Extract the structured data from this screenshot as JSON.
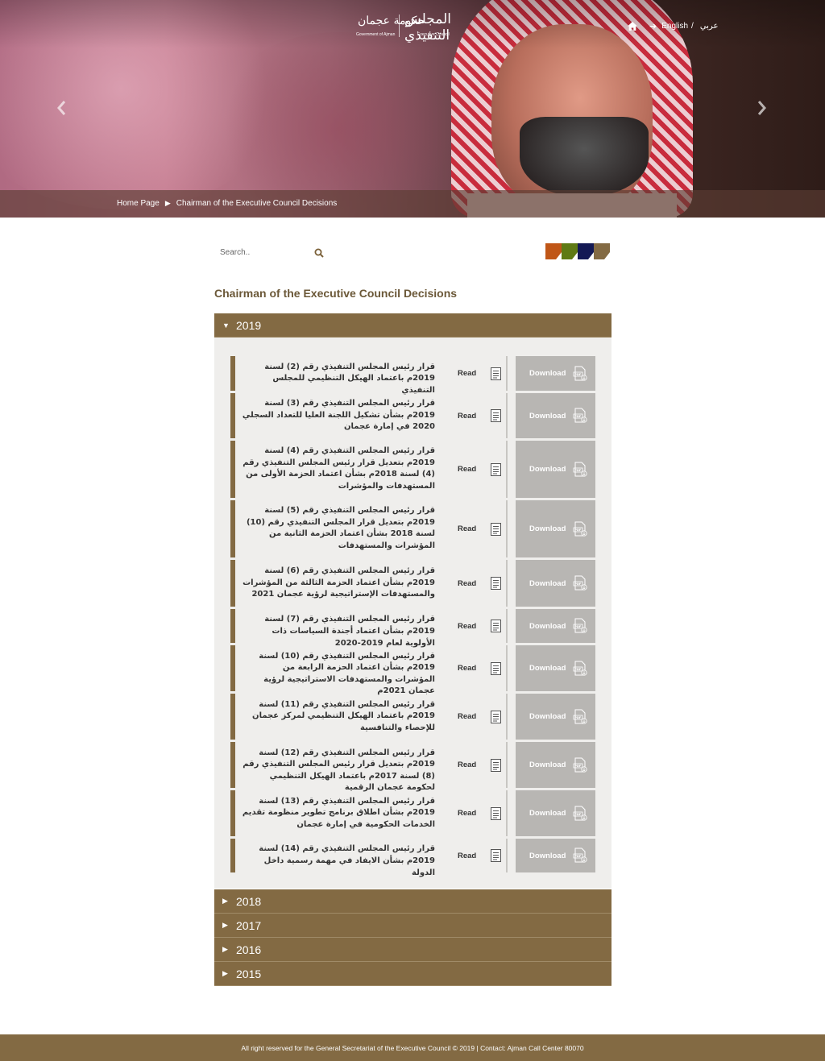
{
  "header": {
    "logo_ar_council": "المجلس التنفيذي",
    "logo_ar_gov": "حكومة عجمان",
    "logo_en_gov": "Government of Ajman",
    "logo_en_council": "Executive Council",
    "lang_english": "English",
    "lang_slash": "/",
    "lang_arabic": "عربي"
  },
  "breadcrumb": {
    "home": "Home Page",
    "current": "Chairman of the Executive Council Decisions"
  },
  "search": {
    "placeholder": "Search.."
  },
  "colors": {
    "brand": "#836a43",
    "themes": [
      "#c05617",
      "#5f7a14",
      "#141954",
      "#836a43"
    ]
  },
  "page_title": "Chairman of the Executive Council Decisions",
  "labels": {
    "read": "Read",
    "download": "Download"
  },
  "years": [
    {
      "year": "2019",
      "expanded": true,
      "items": [
        {
          "title": "قرار رئيس المجلس التنفيذي رقم (2) لسنة 2019م باعتماد الهيكل التنظيمي للمجلس التنفيذي"
        },
        {
          "title": "قرار رئيس المجلس التنفيذي رقم (3) لسنة 2019م بشأن تشكيل اللجنة العليا للتعداد السجلي 2020 في إمارة عجمان"
        },
        {
          "title": "قرار رئيس المجلس التنفيذي رقم (4) لسنة 2019م بتعديل قرار رئيس المجلس التنفيذي رقم (4) لسنة 2018م بشأن اعتماد الحزمة الأولى من المستهدفات والمؤشرات"
        },
        {
          "title": "قرار رئيس المجلس التنفيذي رقم (5) لسنة 2019م بتعديل قرار المجلس التنفيذي رقم (10) لسنة 2018 بشأن اعتماد الحزمة الثانية من المؤشرات والمستهدفات"
        },
        {
          "title": "قرار رئيس المجلس التنفيذي رقم (6) لسنة 2019م بشأن اعتماد الحزمة الثالثة من المؤشرات والمستهدفات الإستراتيجية لرؤية عجمان 2021"
        },
        {
          "title": "قرار رئيس المجلس التنفيذي رقم (7) لسنة 2019م بشأن اعتماد أجندة السياسات ذات الأولوية لعام 2019-2020"
        },
        {
          "title": "قرار رئيس المجلس التنفيذي رقم (10) لسنة 2019م بشأن اعتماد الحزمة الرابعة من المؤشرات والمستهدفات الاستراتيجية لرؤية عجمان 2021م"
        },
        {
          "title": "قرار رئيس المجلس التنفيذي رقم (11) لسنة 2019م باعتماد الهيكل التنظيمي لمركز عجمان للإحصاء والتنافسية"
        },
        {
          "title": "قرار رئيس المجلس التنفيذي رقم (12) لسنة 2019م بتعديل قرار رئيس المجلس التنفيذي رقم (8) لسنة 2017م باعتماد الهيكل التنظيمي لحكومة عجمان الرقمية"
        },
        {
          "title": "قرار رئيس المجلس التنفيذي رقم (13) لسنة 2019م بشأن اطلاق برنامج تطوير منظومة تقديم الخدمات الحكومية في إمارة عجمان"
        },
        {
          "title": "قرار رئيس المجلس التنفيذي رقم (14) لسنة 2019م بشأن الايفاد في مهمة رسمية داخل الدولة"
        }
      ]
    },
    {
      "year": "2018",
      "expanded": false
    },
    {
      "year": "2017",
      "expanded": false
    },
    {
      "year": "2016",
      "expanded": false
    },
    {
      "year": "2015",
      "expanded": false
    }
  ],
  "footer": {
    "text": "All right reserved for the General Secretariat of the Executive Council © 2019 | Contact: Ajman Call Center 80070"
  }
}
